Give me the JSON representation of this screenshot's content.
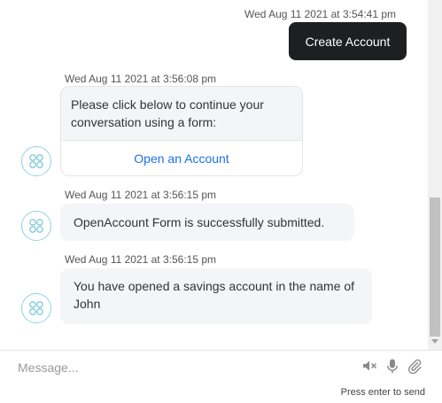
{
  "messages": {
    "user_timestamp": "Wed Aug 11 2021 at 3:54:41 pm",
    "user_text": "Create Account",
    "card_timestamp": "Wed Aug 11 2021 at 3:56:08 pm",
    "card_text": "Please click below to continue your conversation using a form:",
    "card_link": "Open an Account",
    "bot1_timestamp": "Wed Aug 11 2021 at 3:56:15 pm",
    "bot1_text": "OpenAccount Form is successfully submitted.",
    "bot2_timestamp": "Wed Aug 11 2021 at 3:56:15 pm",
    "bot2_text": "You have opened a savings account in the name of John"
  },
  "composer": {
    "placeholder": "Message...",
    "hint": "Press enter to send"
  },
  "icons": {
    "avatar": "bot-avatar-icon",
    "speaker": "speaker-mute-icon",
    "mic": "microphone-icon",
    "attach": "paperclip-icon"
  },
  "colors": {
    "user_bubble": "#1d1f21",
    "bot_bubble": "#f4f5f7",
    "link": "#1a73e8",
    "avatar_border": "#8fd3e0"
  }
}
